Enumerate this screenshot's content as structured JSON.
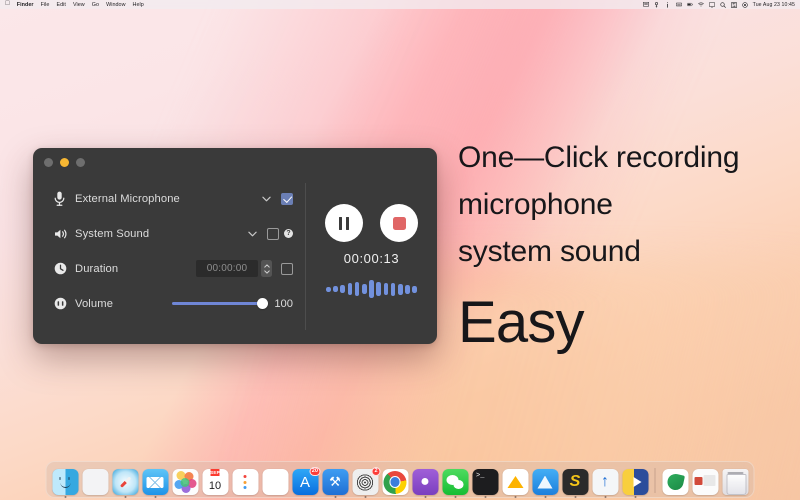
{
  "menubar": {
    "apple_glyph": "",
    "items": [
      "Finder",
      "File",
      "Edit",
      "View",
      "Go",
      "Window",
      "Help"
    ],
    "status_icons": [
      "screen-share-icon",
      "key-icon",
      "info-icon",
      "keyboard-icon",
      "battery-icon",
      "wifi-icon",
      "display-icon",
      "search-icon",
      "control-center-icon",
      "siri-icon"
    ],
    "clock": "Tue Aug 23  10:45"
  },
  "window": {
    "traffic_lights": {
      "close": "close-button",
      "minimize": "minimize-button",
      "zoom": "zoom-button"
    },
    "settings": [
      {
        "icon": "microphone-icon",
        "label": "External Microphone",
        "has_chevron": true,
        "checked": true,
        "has_help": false
      },
      {
        "icon": "speaker-icon",
        "label": "System Sound",
        "has_chevron": true,
        "checked": false,
        "has_help": true,
        "help_glyph": "?"
      },
      {
        "icon": "clock-icon",
        "label": "Duration",
        "value": "00:00:00",
        "checked": false
      },
      {
        "icon": "volume-icon",
        "label": "Volume",
        "value": "100",
        "slider_percent": 100
      }
    ],
    "controls": {
      "pause_label": "pause-button",
      "stop_label": "stop-button",
      "timer": "00:00:13",
      "waveform": [
        5,
        6,
        8,
        12,
        14,
        10,
        18,
        14,
        12,
        13,
        11,
        9,
        7
      ],
      "waveform_color": "#7291dd",
      "stop_color": "#e06666"
    }
  },
  "marketing": {
    "line1": "One—Click recording",
    "line2": "microphone",
    "line3": "system sound",
    "headline": "Easy"
  },
  "dock": {
    "items": [
      {
        "name": "finder",
        "art": "ic-finder",
        "running": true
      },
      {
        "name": "launchpad",
        "art": "ic-launchpad",
        "running": false
      },
      {
        "name": "safari",
        "art": "ic-safari",
        "running": true
      },
      {
        "name": "mail",
        "art": "ic-mail",
        "running": true
      },
      {
        "name": "photos",
        "art": "ic-photos",
        "running": false
      },
      {
        "name": "calendar",
        "art": "ic-calendar",
        "running": false,
        "cal_month": "SEP",
        "cal_day": "10"
      },
      {
        "name": "reminders",
        "art": "ic-reminders",
        "running": false
      },
      {
        "name": "notes",
        "art": "ic-notes",
        "running": false
      },
      {
        "name": "app-store",
        "art": "ic-appstore",
        "running": false,
        "badge": "20",
        "glyph": "A"
      },
      {
        "name": "xcode",
        "art": "ic-xcode",
        "running": true,
        "glyph": "⚒"
      },
      {
        "name": "activity-app",
        "art": "ic-spiral",
        "running": true,
        "badge": "2"
      },
      {
        "name": "chrome",
        "art": "ic-chrome",
        "running": false
      },
      {
        "name": "github",
        "art": "ic-github",
        "running": true,
        "glyph": "●"
      },
      {
        "name": "wechat",
        "art": "ic-wechat",
        "running": true
      },
      {
        "name": "terminal",
        "art": "ic-terminal",
        "running": true,
        "glyph": ">_"
      },
      {
        "name": "sketch",
        "art": "ic-sketch",
        "running": true
      },
      {
        "name": "blue-app",
        "art": "ic-blue",
        "running": true
      },
      {
        "name": "sublime-text",
        "art": "ic-sublime",
        "running": true,
        "glyph": "S"
      },
      {
        "name": "uploader",
        "art": "ic-uparrow",
        "running": true,
        "glyph": "↑"
      },
      {
        "name": "media-player",
        "art": "ic-mediaplay",
        "running": true
      }
    ],
    "second_group": [
      {
        "name": "green-app",
        "art": "ic-greenapp",
        "running": false
      },
      {
        "name": "document-preview",
        "art": "ic-thumb",
        "running": false
      }
    ],
    "trash": {
      "name": "trash",
      "art": "ic-trash"
    }
  }
}
